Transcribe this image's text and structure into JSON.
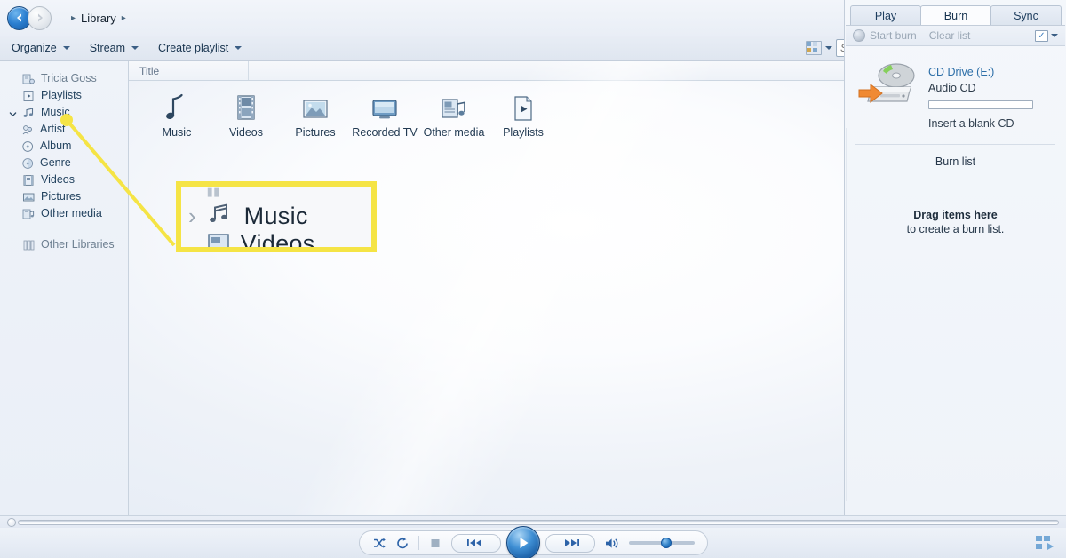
{
  "nav": {
    "back_icon": "back-arrow-icon",
    "forward_icon": "forward-arrow-icon",
    "breadcrumb": {
      "root": "Library"
    }
  },
  "toolbar": {
    "organize": "Organize",
    "stream": "Stream",
    "create_playlist": "Create playlist",
    "view_options_icon": "view-options-icon",
    "search_placeholder": "Search",
    "search_value": "",
    "search_icon": "search-icon",
    "help_label": "?"
  },
  "sidebar": {
    "items": [
      {
        "label": "Tricia Goss",
        "icon": "library-user-icon",
        "level": 0,
        "dim": true,
        "expander": ""
      },
      {
        "label": "Playlists",
        "icon": "playlists-icon",
        "level": 0,
        "dim": false,
        "expander": ""
      },
      {
        "label": "Music",
        "icon": "music-note-icon",
        "level": 0,
        "dim": false,
        "expander": "chevron-down-icon"
      },
      {
        "label": "Artist",
        "icon": "artist-icon",
        "level": 1,
        "dim": false,
        "expander": ""
      },
      {
        "label": "Album",
        "icon": "album-icon",
        "level": 1,
        "dim": false,
        "expander": ""
      },
      {
        "label": "Genre",
        "icon": "genre-icon",
        "level": 1,
        "dim": false,
        "expander": ""
      },
      {
        "label": "Videos",
        "icon": "videos-icon",
        "level": 0,
        "dim": false,
        "expander": ""
      },
      {
        "label": "Pictures",
        "icon": "pictures-icon",
        "level": 0,
        "dim": false,
        "expander": ""
      },
      {
        "label": "Other media",
        "icon": "other-media-icon",
        "level": 0,
        "dim": false,
        "expander": ""
      }
    ],
    "other_libraries": {
      "label": "Other Libraries",
      "icon": "other-libraries-icon"
    }
  },
  "main": {
    "column_header": {
      "title": "Title"
    },
    "tiles": [
      {
        "label": "Music",
        "icon": "music-note-icon"
      },
      {
        "label": "Videos",
        "icon": "film-strip-icon"
      },
      {
        "label": "Pictures",
        "icon": "picture-frame-icon"
      },
      {
        "label": "Recorded TV",
        "icon": "television-icon"
      },
      {
        "label": "Other media",
        "icon": "other-media-icon"
      },
      {
        "label": "Playlists",
        "icon": "playlist-page-icon"
      }
    ]
  },
  "callout": {
    "highlight_color": "#f5e445",
    "chevron_icon": "chevron-right-icon",
    "music_icon": "music-notes-icon",
    "label": "Music",
    "clipped_label": "Videos"
  },
  "right_pane": {
    "tabs": [
      {
        "label": "Play",
        "active": false
      },
      {
        "label": "Burn",
        "active": true
      },
      {
        "label": "Sync",
        "active": false
      }
    ],
    "pane_toolbar": {
      "start_burn": "Start burn",
      "start_burn_icon": "burn-disc-icon",
      "clear_list": "Clear list",
      "options_icon": "list-options-icon"
    },
    "drive": {
      "icon": "cd-drive-icon",
      "name": "CD Drive (E:)",
      "media_type": "Audio CD",
      "capacity_percent": 0,
      "hint": "Insert a blank CD"
    },
    "burn_list": {
      "title": "Burn list",
      "empty_strong": "Drag items here",
      "empty_sub": "to create a burn list."
    }
  },
  "player": {
    "seek_position_percent": 0,
    "controls": [
      {
        "name": "shuffle-button",
        "label": "Shuffle"
      },
      {
        "name": "repeat-button",
        "label": "Repeat"
      },
      {
        "name": "stop-button",
        "label": "Stop"
      },
      {
        "name": "previous-button",
        "label": "Previous"
      },
      {
        "name": "play-button",
        "label": "Play"
      },
      {
        "name": "next-button",
        "label": "Next"
      },
      {
        "name": "mute-button",
        "label": "Mute"
      }
    ],
    "volume_percent": 50,
    "switch_to_now_playing_icon": "switch-to-now-playing-icon"
  },
  "colors": {
    "accent_blue": "#2c6ea8",
    "highlight_yellow": "#f5e445",
    "chrome": "#e8edf5"
  }
}
